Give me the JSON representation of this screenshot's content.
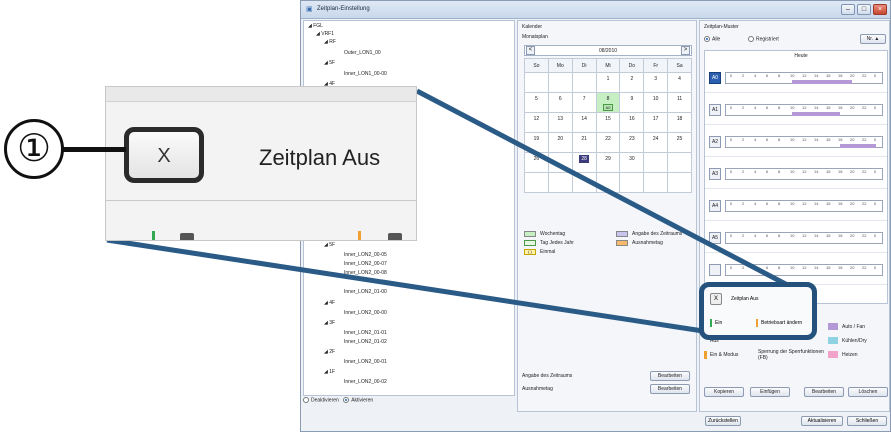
{
  "window": {
    "title": "Zeitplan-Einstellung",
    "controls": [
      "–",
      "□",
      "×"
    ]
  },
  "tree": {
    "nodes": [
      {
        "label": "◢ FGL"
      },
      {
        "label": "◢ VRF1"
      },
      {
        "label": "◢ RF"
      },
      {
        "label": "Outer_LON1_00"
      },
      {
        "label": "◢ 5F"
      },
      {
        "label": "Inner_LON1_00-00"
      },
      {
        "label": "◢ 4F"
      },
      {
        "label": "◢ 5F"
      },
      {
        "label": "Inner_LON2_00-05"
      },
      {
        "label": "Inner_LON2_00-07"
      },
      {
        "label": "Inner_LON2_00-08"
      },
      {
        "label": "Inner_LON2_01-00"
      },
      {
        "label": "◢ 4F"
      },
      {
        "label": "Inner_LON2_00-00"
      },
      {
        "label": "◢ 3F"
      },
      {
        "label": "Inner_LON2_01-01"
      },
      {
        "label": "Inner_LON2_01-02"
      },
      {
        "label": "◢ 2F"
      },
      {
        "label": "Inner_LON2_00-01"
      },
      {
        "label": "◢ 1F"
      },
      {
        "label": "Inner_LON2_00-02"
      }
    ],
    "mode": {
      "deactivate": "Deaktivieren",
      "activate": "Aktivieren"
    }
  },
  "calendar": {
    "header": "Kalender",
    "subheader": "Monatsplan",
    "month": "08/2010",
    "prev": "<",
    "next": ">",
    "weekdays": [
      "So",
      "Mo",
      "Di",
      "Mi",
      "Do",
      "Fr",
      "Sa"
    ],
    "weeks": [
      [
        "",
        "",
        "",
        "1",
        "2",
        "3",
        "4"
      ],
      [
        "5",
        "6",
        "7",
        "8",
        "9",
        "10",
        "11"
      ],
      [
        "12",
        "13",
        "14",
        "15",
        "16",
        "17",
        "18"
      ],
      [
        "19",
        "20",
        "21",
        "22",
        "23",
        "24",
        "25"
      ],
      [
        "26",
        "",
        "28",
        "29",
        "30",
        "",
        ""
      ],
      [
        "",
        "",
        "",
        "",
        "",
        "",
        ""
      ]
    ],
    "today_tag": "A0",
    "legend": {
      "weekday": "Wochentag",
      "yearly": "Tag Jedes Jahr",
      "once": "Einmal",
      "once_symbol": "( )",
      "period": "Angabe des Zeitraums",
      "exception": "Ausnahmetag"
    },
    "period_label": "Angabe des Zeitraums",
    "exception_label": "Ausnahmetag",
    "edit_label": "Bearbeiten"
  },
  "pattern": {
    "header": "Zeitplan-Muster",
    "filter_all": "Alle",
    "filter_registered": "Registriert",
    "sort": "Nr. ▲",
    "today": "Heute",
    "ticks": [
      "0",
      "2",
      "4",
      "6",
      "8",
      "10",
      "12",
      "14",
      "16",
      "18",
      "20",
      "22",
      "0"
    ],
    "rows": [
      {
        "id": "A0",
        "active": true,
        "bars": [
          {
            "from": 10,
            "to": 20,
            "color": "#b39ad7"
          }
        ]
      },
      {
        "id": "A1",
        "active": false,
        "bars": [
          {
            "from": 10,
            "to": 18,
            "color": "#b39ad7"
          }
        ]
      },
      {
        "id": "A2",
        "active": false,
        "bars": [
          {
            "from": 18,
            "to": 24,
            "color": "#b39ad7"
          }
        ]
      },
      {
        "id": "A3",
        "active": false,
        "bars": []
      },
      {
        "id": "A4",
        "active": false,
        "bars": []
      },
      {
        "id": "A5",
        "active": false,
        "bars": []
      },
      {
        "id": "",
        "active": false,
        "bars": []
      }
    ],
    "schedule_off_btn": "X",
    "schedule_off": "Zeitplan Aus",
    "legend": {
      "on": "Ein",
      "off": "Aus",
      "on_mode": "Ein & Modus",
      "change_mode": "Betriebsart ändern",
      "lock_fb": "Sperrfunktionen (FB)",
      "lock_fb_lock": "Sperrung der Sperrfunktionen (FB)",
      "auto_fan": "Auto / Fan",
      "cool_dry": "Kühlen/Dry",
      "heat": "Heizen"
    },
    "buttons": {
      "copy": "Kopieren",
      "paste": "Einfügen",
      "edit": "Bearbeiten",
      "delete": "Löschen"
    }
  },
  "footer": {
    "reset": "Zurückstellen",
    "update": "Aktualisieren",
    "close": "Schließen"
  },
  "zoom": {
    "button": "X",
    "text": "Zeitplan Aus",
    "partial_left": "E",
    "partial_right": "B"
  },
  "callout_number": "①",
  "colors": {
    "callout_line": "#2a5a86",
    "active_pattern": "#2a5fb0",
    "bar_purple": "#b39ad7",
    "today_green": "#c7efc4"
  }
}
